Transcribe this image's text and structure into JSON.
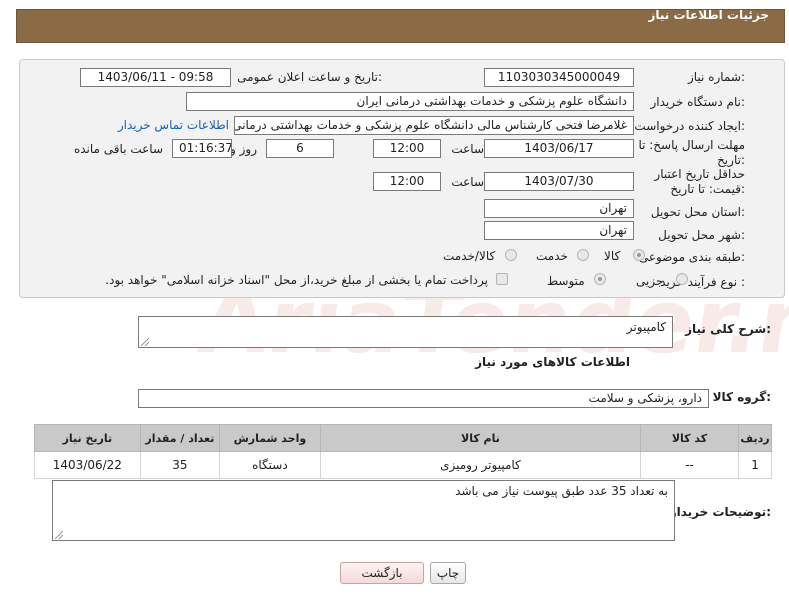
{
  "header": {
    "title": "جزئیات اطلاعات نیاز"
  },
  "form": {
    "need_number": {
      "label": "شماره نیاز:",
      "value": "1103030345000049"
    },
    "announce": {
      "label": "تاریخ و ساعت اعلان عمومی:",
      "value": "1403/06/11 - 09:58"
    },
    "buyer_org": {
      "label": "نام دستگاه خریدار:",
      "value": "دانشگاه علوم پزشکی و خدمات بهداشتی درمانی ایران"
    },
    "requester": {
      "label": "ایجاد کننده درخواست:",
      "value": "غلامرضا فتحی کارشناس مالی دانشگاه علوم پزشکی و خدمات بهداشتی درمانی ایران",
      "contact_link": "اطلاعات تماس خریدار"
    },
    "reply_deadline": {
      "label": "مهلت ارسال پاسخ: تا تاریخ:",
      "date": "1403/06/17",
      "time_label": "ساعت",
      "time": "12:00",
      "days": "6",
      "days_label": "روز و",
      "remaining": "01:16:37",
      "remaining_label": "ساعت باقی مانده"
    },
    "price_validity": {
      "label": "حداقل تاریخ اعتبار قیمت: تا تاریخ:",
      "date": "1403/07/30",
      "time_label": "ساعت",
      "time": "12:00"
    },
    "province": {
      "label": "استان محل تحویل:",
      "value": "تهران"
    },
    "city": {
      "label": "شهر محل تحویل:",
      "value": "تهران"
    },
    "category": {
      "label": "طبقه بندی موضوعی:",
      "options": [
        "کالا",
        "خدمت",
        "کالا/خدمت"
      ],
      "selected": "کالا"
    },
    "process": {
      "label": "نوع فرآیند خرید :",
      "options": [
        "جزیی",
        "متوسط"
      ],
      "selected": "متوسط",
      "payment_note": "پرداخت تمام یا بخشی از مبلغ خرید،از محل \"اسناد خزانه اسلامی\" خواهد بود."
    }
  },
  "summary": {
    "label": "شرح کلی نیاز:",
    "value": "کامپیوتر"
  },
  "goods_info_title": "اطلاعات کالاهای مورد نیاز",
  "goods_group": {
    "label": "گروه کالا:",
    "value": "دارو، پزشکی و سلامت"
  },
  "table": {
    "headers": [
      "ردیف",
      "کد کالا",
      "نام کالا",
      "واحد شمارش",
      "تعداد / مقدار",
      "تاریخ نیاز"
    ],
    "rows": [
      [
        "1",
        "--",
        "کامپیوتر رومیزی",
        "دستگاه",
        "35",
        "1403/06/22"
      ]
    ]
  },
  "buyer_notes": {
    "label": "توضیحات خریدار:",
    "value": "به تعداد 35 عدد طبق پیوست نیاز می باشد"
  },
  "buttons": {
    "print": "چاپ",
    "back": "بازگشت"
  },
  "watermark": "AriaTender.neT",
  "colors": {
    "header": "#8b6a46",
    "link": "#1a5fb4",
    "table_header": "#c9c9c9"
  }
}
